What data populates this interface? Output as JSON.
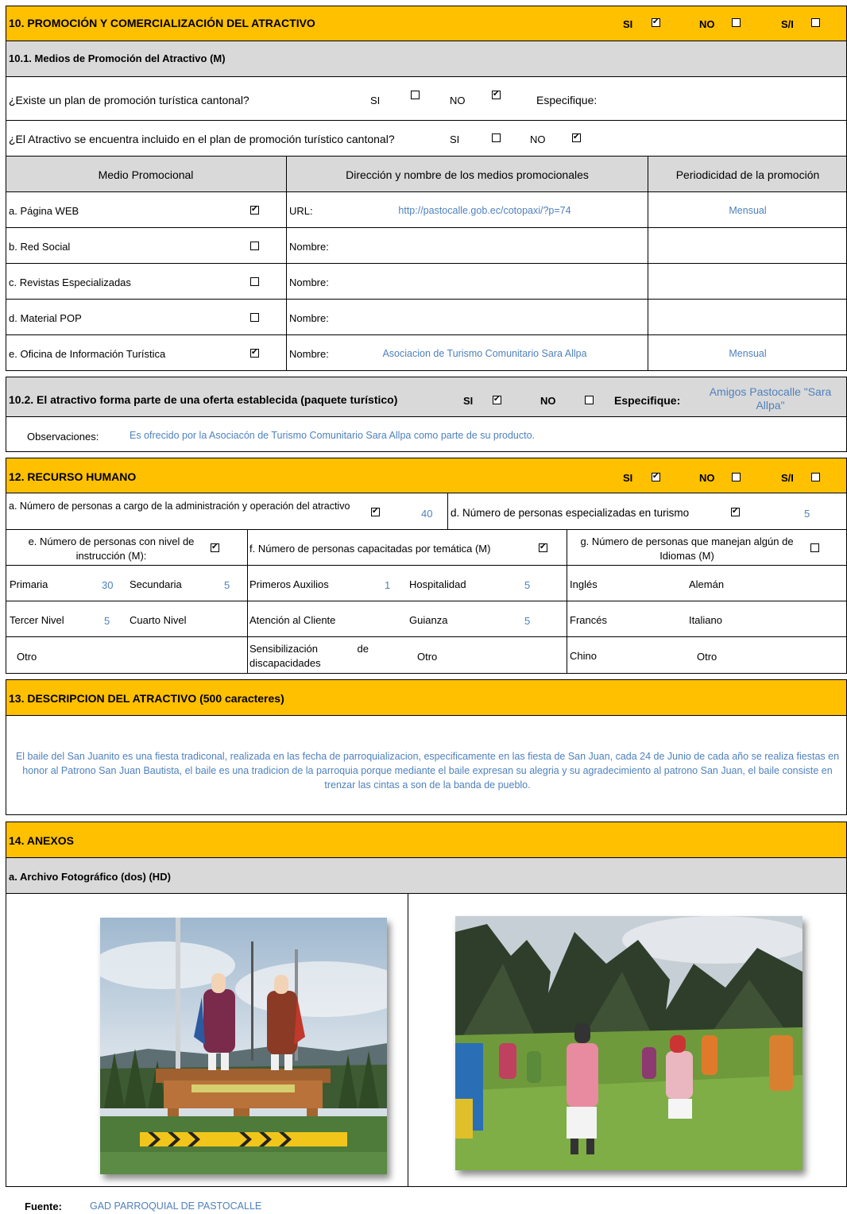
{
  "s10": {
    "title": "10. PROMOCIÓN Y COMERCIALIZACIÓN DEL ATRACTIVO",
    "si": "SI",
    "no": "NO",
    "sn": "S/I",
    "si_checked": true,
    "no_checked": false,
    "sn_checked": false
  },
  "s101": {
    "title": "10.1. Medios de Promoción del Atractivo (M)",
    "q1": "¿Existe un plan de promoción turística cantonal?",
    "q1_si": "SI",
    "q1_no": "NO",
    "q1_si_checked": false,
    "q1_no_checked": true,
    "q1_specify": "Especifique:",
    "q2": "¿El Atractivo se encuentra incluido en el plan de promoción turístico cantonal?",
    "q2_si": "SI",
    "q2_no": "NO",
    "q2_si_checked": false,
    "q2_no_checked": true,
    "col_medio": "Medio Promocional",
    "col_direccion": "Dirección y nombre de los medios promocionales",
    "col_periodicidad": "Periodicidad de la promoción",
    "rows": [
      {
        "medio": "a. Página WEB",
        "checked": true,
        "label": "URL:",
        "value": "http://pastocalle.gob.ec/cotopaxi/?p=74",
        "period": "Mensual"
      },
      {
        "medio": "b. Red Social",
        "checked": false,
        "label": "Nombre:",
        "value": "",
        "period": ""
      },
      {
        "medio": "c. Revistas Especializadas",
        "checked": false,
        "label": "Nombre:",
        "value": "",
        "period": ""
      },
      {
        "medio": "d. Material POP",
        "checked": false,
        "label": "Nombre:",
        "value": "",
        "period": ""
      },
      {
        "medio": "e. Oficina de Información Turística",
        "checked": true,
        "label": "Nombre:",
        "value": "Asociacion de Turismo Comunitario Sara Allpa",
        "period": "Mensual"
      }
    ]
  },
  "s102": {
    "title": "10.2. El atractivo forma parte de una oferta establecida (paquete turístico)",
    "si": "SI",
    "no": "NO",
    "si_checked": true,
    "no_checked": false,
    "specify": "Especifique:",
    "specify_value": "Amigos Pastocalle \"Sara Allpa\"",
    "obs_label": "Observaciones:",
    "obs_value": "Es ofrecido por la Asociacón de Turismo Comunitario Sara Allpa como parte de su producto."
  },
  "s12": {
    "title": "12. RECURSO HUMANO",
    "si": "SI",
    "no": "NO",
    "sn": "S/I",
    "si_checked": true,
    "no_checked": false,
    "sn_checked": false,
    "a_label": "a. Número de personas a cargo de la administración y operación del atractivo",
    "a_checked": true,
    "a_value": "40",
    "d_label": "d. Número de personas especializadas en turismo",
    "d_checked": true,
    "d_value": "5",
    "e_label": "e. Número de personas con nivel de instrucción (M):",
    "e_checked": true,
    "f_label": "f. Número de personas capacitadas por temática (M)",
    "f_checked": true,
    "g_label": "g. Número de personas que manejan algún de Idiomas (M)",
    "g_checked": false,
    "primaria": "Primaria",
    "primaria_v": "30",
    "secundaria": "Secundaria",
    "secundaria_v": "5",
    "tercer": "Tercer Nivel",
    "tercer_v": "5",
    "cuarto": "Cuarto Nivel",
    "cuarto_v": "",
    "otro1": "Otro",
    "auxilios": "Primeros Auxilios",
    "auxilios_v": "1",
    "hospitalidad": "Hospitalidad",
    "hospitalidad_v": "5",
    "atencion": "Atención al Cliente",
    "atencion_v": "",
    "guianza": "Guianza",
    "guianza_v": "5",
    "sensib": "Sensibilización de discapacidades",
    "otro2": "Otro",
    "ingles": "Inglés",
    "aleman": "Alemán",
    "frances": "Francés",
    "italiano": "Italiano",
    "chino": "Chino",
    "otro3": "Otro"
  },
  "s13": {
    "title": "13. DESCRIPCION DEL ATRACTIVO (500 caracteres)",
    "text": "El baile del San Juanito es una fiesta tradiconal, realizada en las fecha de parroquializacion, especificamente en las fiesta de San Juan, cada 24 de Junio de cada año se realiza fiestas en honor al Patrono San Juan Bautista, el baile es una tradicion de la parroquia porque mediante el baile expresan su alegria y su agradecimiento al patrono San Juan, el baile consiste en trenzar las cintas a son de la banda de pueblo."
  },
  "s14": {
    "title": "14. ANEXOS",
    "sub": "a. Archivo Fotográfico (dos) (HD)",
    "source_label": "Fuente:",
    "source_value": "GAD PARROQUIAL DE PASTOCALLE"
  },
  "colors": {
    "header": "#ffc000",
    "subheader": "#d9d9d9",
    "value": "#4f81bd"
  }
}
